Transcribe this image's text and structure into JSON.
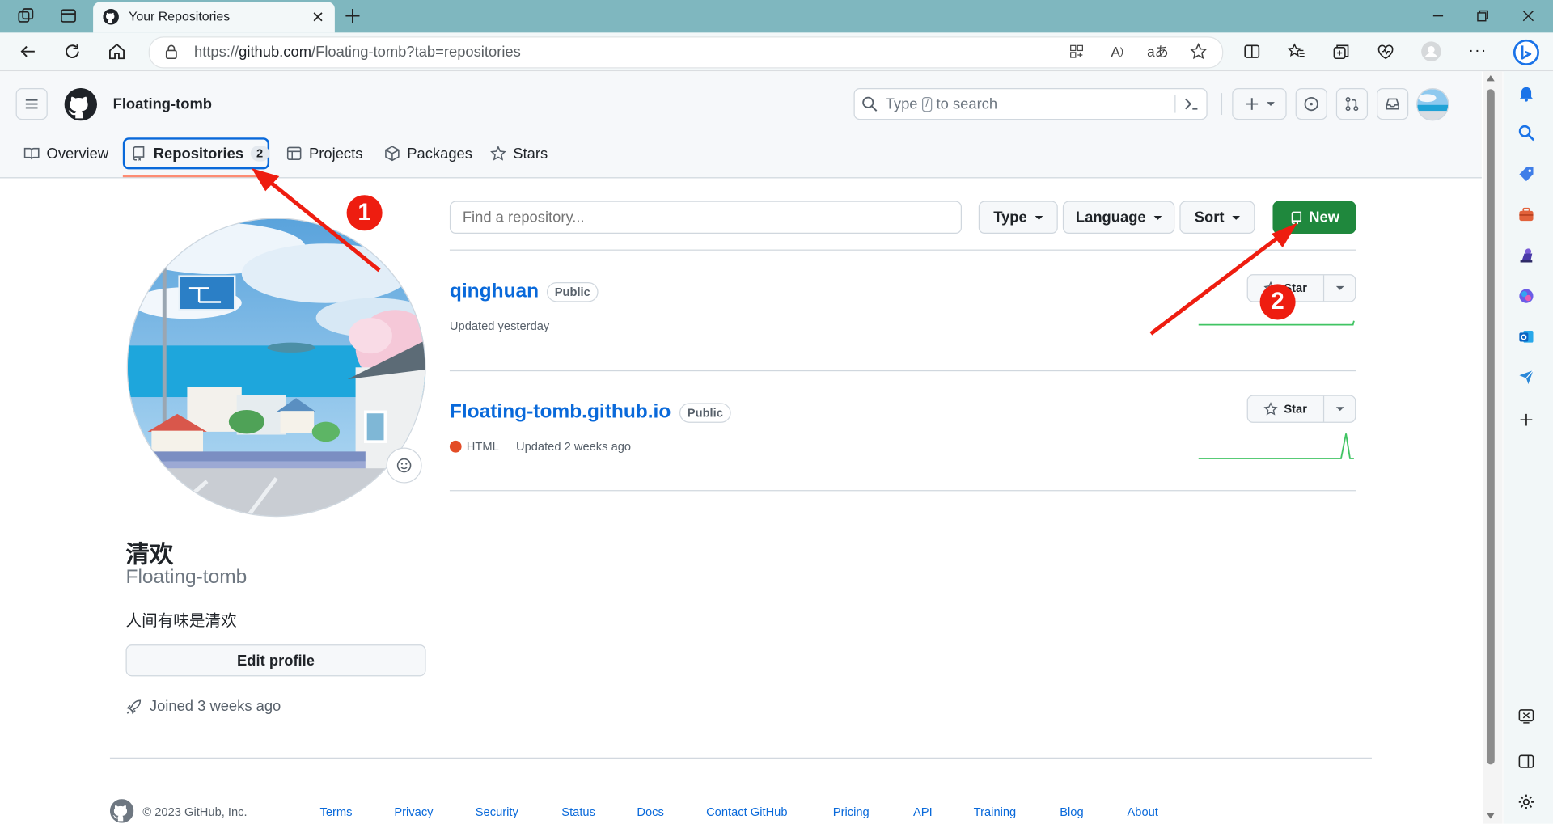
{
  "browser": {
    "tab_title": "Your Repositories",
    "url_prefix": "https://",
    "url_domain": "github.com",
    "url_path": "/Floating-tomb?tab=repositories"
  },
  "github": {
    "username_header": "Floating-tomb",
    "search_prefix": "Type",
    "search_slash": "/",
    "search_suffix": "to search",
    "nav": {
      "overview": "Overview",
      "repositories": "Repositories",
      "repositories_count": "2",
      "projects": "Projects",
      "packages": "Packages",
      "stars": "Stars"
    }
  },
  "profile": {
    "full_name": "清欢",
    "username": "Floating-tomb",
    "bio": "人间有味是清欢",
    "edit_profile_label": "Edit profile",
    "joined": "Joined 3 weeks ago"
  },
  "repo_filters": {
    "search_placeholder": "Find a repository...",
    "type_label": "Type",
    "language_label": "Language",
    "sort_label": "Sort",
    "new_label": "New"
  },
  "repositories": [
    {
      "name": "qinghuan",
      "visibility": "Public",
      "language": "",
      "updated": "Updated yesterday",
      "star_label": "Star"
    },
    {
      "name": "Floating-tomb.github.io",
      "visibility": "Public",
      "language": "HTML",
      "language_color": "#e34c26",
      "updated": "Updated 2 weeks ago",
      "star_label": "Star"
    }
  ],
  "annotations": {
    "marker_1": "1",
    "marker_2": "2",
    "marker_color": "#ee1d10"
  },
  "footer": {
    "copyright": "© 2023 GitHub, Inc.",
    "links": [
      "Terms",
      "Privacy",
      "Security",
      "Status",
      "Docs",
      "Contact GitHub",
      "Pricing",
      "API",
      "Training",
      "Blog",
      "About"
    ]
  }
}
